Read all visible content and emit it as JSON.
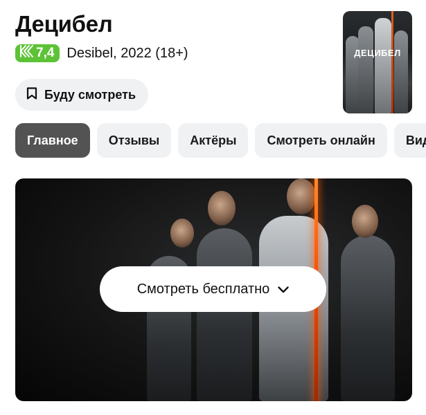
{
  "movie": {
    "title": "Децибел",
    "rating": "7,4",
    "meta": "Desibel, 2022 (18+)",
    "poster_title": "ДЕЦИБЕЛ"
  },
  "actions": {
    "watch_later": "Буду смотреть",
    "watch_free": "Смотреть бесплатно"
  },
  "tabs": [
    {
      "label": "Главное",
      "active": true
    },
    {
      "label": "Отзывы"
    },
    {
      "label": "Актёры"
    },
    {
      "label": "Смотреть онлайн"
    },
    {
      "label": "Видео"
    }
  ],
  "colors": {
    "rating_bg": "#5dc236",
    "active_tab_bg": "#535353",
    "accent_line": "#ff4d00"
  },
  "icons": [
    "kinopoisk-k-icon",
    "bookmark-icon",
    "chevron-down-icon"
  ]
}
